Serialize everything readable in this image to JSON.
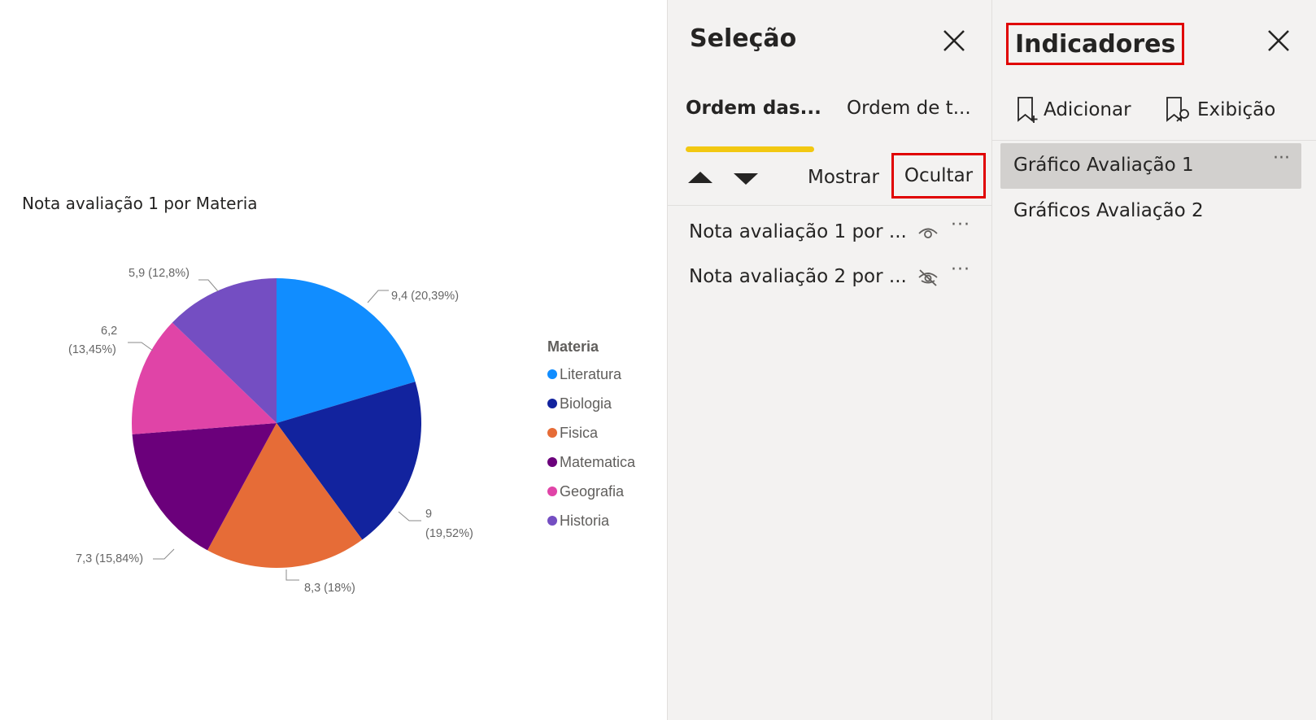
{
  "canvas": {
    "chart_title": "Nota avaliação 1 por Materia",
    "legend_title": "Materia",
    "legend": [
      {
        "label": "Literatura",
        "color": "#118dff"
      },
      {
        "label": "Biologia",
        "color": "#12239e"
      },
      {
        "label": "Fisica",
        "color": "#e66c37"
      },
      {
        "label": "Matematica",
        "color": "#6b007b"
      },
      {
        "label": "Geografia",
        "color": "#e044a7"
      },
      {
        "label": "Historia",
        "color": "#744ec2"
      }
    ],
    "data_labels": {
      "literatura": "9,4 (20,39%)",
      "biologia_value": "9",
      "biologia_pct": "(19,52%)",
      "fisica": "8,3 (18%)",
      "matematica": "7,3 (15,84%)",
      "geografia_value": "6,2",
      "geografia_pct": "(13,45%)",
      "historia": "5,9 (12,8%)"
    }
  },
  "chart_data": {
    "type": "pie",
    "title": "Nota avaliação 1 por Materia",
    "legend_title": "Materia",
    "legend_position": "right",
    "categories": [
      "Literatura",
      "Biologia",
      "Fisica",
      "Matematica",
      "Geografia",
      "Historia"
    ],
    "values": [
      9.4,
      9,
      8.3,
      7.3,
      6.2,
      5.9
    ],
    "percentages": [
      20.39,
      19.52,
      18,
      15.84,
      13.45,
      12.8
    ],
    "colors": [
      "#118dff",
      "#12239e",
      "#e66c37",
      "#6b007b",
      "#e044a7",
      "#744ec2"
    ]
  },
  "selection_pane": {
    "title": "Seleção",
    "close_icon": "close-icon",
    "tabs": [
      "Ordem das...",
      "Ordem de t..."
    ],
    "move_up_icon": "triangle-up-icon",
    "move_down_icon": "triangle-down-icon",
    "show_label": "Mostrar",
    "hide_label": "Ocultar",
    "items": [
      {
        "label": "Nota avaliação 1 por ...",
        "visibility_icon": "eye-icon",
        "more": "···"
      },
      {
        "label": "Nota avaliação 2 por ...",
        "visibility_icon": "eye-hidden-icon",
        "more": "···"
      }
    ]
  },
  "bookmarks_pane": {
    "title": "Indicadores",
    "close_icon": "close-icon",
    "add_label": "Adicionar",
    "view_label": "Exibição",
    "items": [
      {
        "label": "Gráfico Avaliação 1",
        "selected": true,
        "more": "···"
      },
      {
        "label": "Gráficos Avaliação 2",
        "selected": false
      }
    ]
  }
}
